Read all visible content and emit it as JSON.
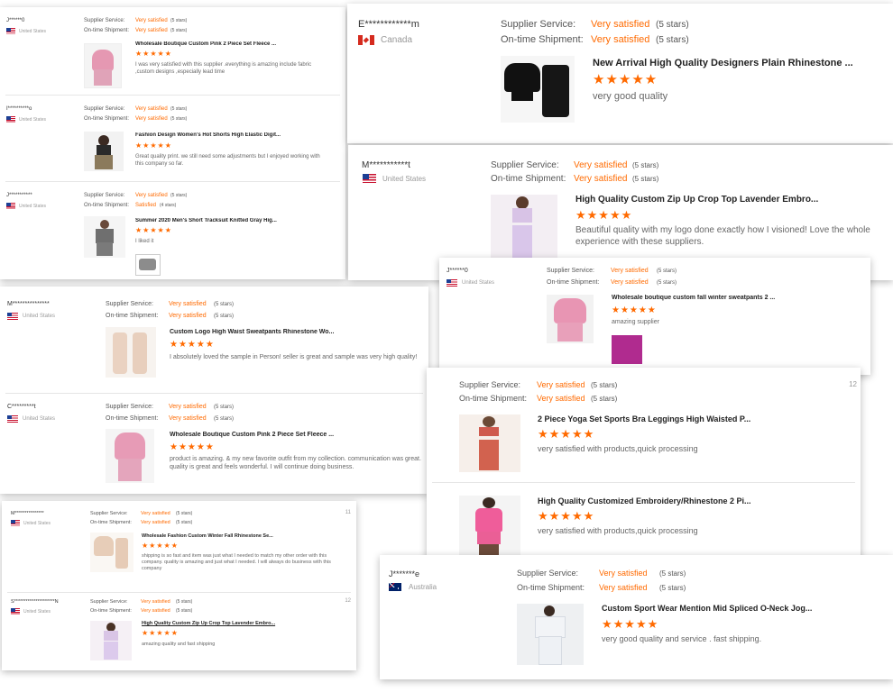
{
  "cards": [
    {
      "reviews": [
        {
          "user": "J******0",
          "country": "United States",
          "flag": "us",
          "supplier_label": "Supplier Service:",
          "supplier_value": "Very satisfied",
          "supplier_stars": "(5 stars)",
          "shipment_label": "On-time Shipment:",
          "shipment_value": "Very satisfied",
          "shipment_stars": "(5 stars)",
          "product": "Wholesale Boutique Custom Pink 2 Piece Set Fleece ...",
          "rating": "★★★★★",
          "comment": "I was very satisfied with this supplier .everything is amazing include fabric ,custom designs ,especially lead time"
        },
        {
          "user": "I**********o",
          "country": "United States",
          "flag": "us",
          "supplier_label": "Supplier Service:",
          "supplier_value": "Very satisfied",
          "supplier_stars": "(5 stars)",
          "shipment_label": "On-time Shipment:",
          "shipment_value": "Very satisfied",
          "shipment_stars": "(5 stars)",
          "product": "Fashion Design Women's Hot Shorts High Elastic Digit...",
          "rating": "★★★★★",
          "comment": "Great quality print. we still need some adjustments but I enjoyed working with this company so far."
        },
        {
          "user": "J***********",
          "country": "United States",
          "flag": "us",
          "supplier_label": "Supplier Service:",
          "supplier_value": "Very satisfied",
          "supplier_stars": "(5 stars)",
          "shipment_label": "On-time Shipment:",
          "shipment_value": "Satisfied",
          "shipment_stars": "(4 stars)",
          "product": "Summer 2020 Men's Short Tracksuit Knitted Gray Hig...",
          "rating": "★★★★★",
          "comment": "I liked it"
        }
      ]
    },
    {
      "reviews": [
        {
          "user": "E************m",
          "country": "Canada",
          "flag": "ca",
          "supplier_label": "Supplier Service:",
          "supplier_value": "Very satisfied",
          "supplier_stars": "(5 stars)",
          "shipment_label": "On-time Shipment:",
          "shipment_value": "Very satisfied",
          "shipment_stars": "(5 stars)",
          "product": "New Arrival High Quality Designers Plain Rhinestone ...",
          "rating": "★★★★★",
          "comment": "very good quality"
        }
      ]
    },
    {
      "reviews": [
        {
          "user": "M***********t",
          "country": "United States",
          "flag": "us",
          "supplier_label": "Supplier Service:",
          "supplier_value": "Very satisfied",
          "supplier_stars": "(5 stars)",
          "shipment_label": "On-time Shipment:",
          "shipment_value": "Very satisfied",
          "shipment_stars": "(5 stars)",
          "product": "High Quality Custom Zip Up Crop Top Lavender Embro...",
          "rating": "★★★★★",
          "comment": "Beautiful quality with my logo done exactly how I visioned! Love the whole experience with these suppliers."
        }
      ]
    },
    {
      "reviews": [
        {
          "user": "J******0",
          "country": "United States",
          "flag": "us",
          "supplier_label": "Supplier Service:",
          "supplier_value": "Very satisfied",
          "supplier_stars": "(5 stars)",
          "shipment_label": "On-time Shipment:",
          "shipment_value": "Very satisfied",
          "shipment_stars": "(5 stars)",
          "product": "Wholesale boutique custom fall winter sweatpants 2 ...",
          "rating": "★★★★★",
          "comment": "amazing supplier"
        }
      ]
    },
    {
      "reviews": [
        {
          "user": "M***************",
          "country": "United States",
          "flag": "us",
          "supplier_label": "Supplier Service:",
          "supplier_value": "Very satisfied",
          "supplier_stars": "(5 stars)",
          "shipment_label": "On-time Shipment:",
          "shipment_value": "Very satisfied",
          "shipment_stars": "(5 stars)",
          "product": "Custom Logo High Waist Sweatpants Rhinestone Wo...",
          "rating": "★★★★★",
          "comment": "I absolutely loved the sample in Person! seller is great and sample was very high quality!"
        },
        {
          "user": "C*********t",
          "country": "United States",
          "flag": "us",
          "supplier_label": "Supplier Service:",
          "supplier_value": "Very satisfied",
          "supplier_stars": "(5 stars)",
          "shipment_label": "On-time Shipment:",
          "shipment_value": "Very satisfied",
          "shipment_stars": "(5 stars)",
          "product": "Wholesale Boutique Custom Pink 2 Piece Set Fleece ...",
          "rating": "★★★★★",
          "comment": "product is amazing. & my new favorite outfit from my collection. communication was great.  quality is great and feels wonderful. I will continue doing business."
        }
      ]
    },
    {
      "reviews": [
        {
          "user": "",
          "country": "",
          "flag": "",
          "supplier_label": "Supplier Service:",
          "supplier_value": "Very satisfied",
          "supplier_stars": "(5 stars)",
          "shipment_label": "On-time Shipment:",
          "shipment_value": "Very satisfied",
          "shipment_stars": "(5 stars)",
          "product": "2 Piece Yoga Set Sports Bra Leggings High Waisted P...",
          "rating": "★★★★★",
          "comment": "very satisfied with products,quick processing",
          "count": "12"
        },
        {
          "user": "",
          "country": "",
          "flag": "",
          "supplier_label": "",
          "supplier_value": "",
          "supplier_stars": "",
          "shipment_label": "",
          "shipment_value": "",
          "shipment_stars": "",
          "product": "High Quality Customized Embroidery/Rhinestone 2 Pi...",
          "rating": "★★★★★",
          "comment": "very satisfied with products,quick processing"
        }
      ]
    },
    {
      "reviews": [
        {
          "user": "M***************",
          "country": "United States",
          "flag": "us",
          "supplier_label": "Supplier Service:",
          "supplier_value": "Very satisfied",
          "supplier_stars": "(5 stars)",
          "shipment_label": "On-time Shipment:",
          "shipment_value": "Very satisfied",
          "shipment_stars": "(5 stars)",
          "product": "Wholesale Fashion Custom Winter Fall Rhinestone Se...",
          "rating": "★★★★★",
          "comment": "shipping is so fast and item was just what I needed to match my other order with this company. quality is amazing and just what I needed. I will always do business with this company",
          "count": "11"
        },
        {
          "user": "S*********************N",
          "country": "United States",
          "flag": "us",
          "supplier_label": "Supplier Service:",
          "supplier_value": "Very satisfied",
          "supplier_stars": "(5 stars)",
          "shipment_label": "On-time Shipment:",
          "shipment_value": "Very satisfied",
          "shipment_stars": "(5 stars)",
          "product": "High Quality Custom Zip Up Crop Top Lavender Embro...",
          "rating": "★★★★★",
          "comment": "amazing quality and fast shipping",
          "count": "12"
        }
      ]
    },
    {
      "reviews": [
        {
          "user": "J*******e",
          "country": "Australia",
          "flag": "au",
          "supplier_label": "Supplier Service:",
          "supplier_value": "Very satisfied",
          "supplier_stars": "(5 stars)",
          "shipment_label": "On-time Shipment:",
          "shipment_value": "Very satisfied",
          "shipment_stars": "(5 stars)",
          "product": "Custom Sport Wear Mention Mid Spliced O-Neck Jog...",
          "rating": "★★★★★",
          "comment": "very good quality and service . fast shipping."
        }
      ]
    }
  ],
  "colors": {
    "accent": "#ff6a00",
    "label": "#555555",
    "muted": "#999999"
  }
}
